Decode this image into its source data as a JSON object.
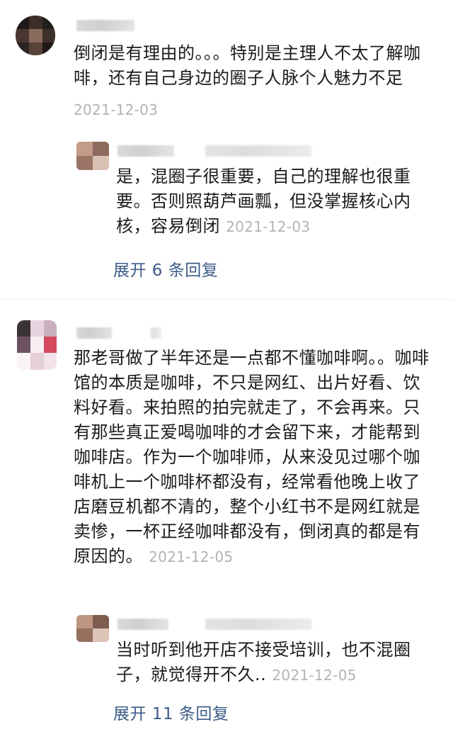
{
  "comments": [
    {
      "text": "倒闭是有理由的。。。特别是主理人不太了解咖啡，还有自己身边的圈子人脉个人魅力不足",
      "date": "2021-12-03",
      "reply": {
        "text": "是，混圈子很重要，自己的理解也很重要。否则照葫芦画瓢，但没掌握核心内核，容易倒闭",
        "date": "2021-12-03"
      },
      "expand_label": "展开 6 条回复"
    },
    {
      "text": "那老哥做了半年还是一点都不懂咖啡啊。。咖啡馆的本质是咖啡，不只是网红、出片好看、饮料好看。来拍照的拍完就走了，不会再来。只有那些真正爱喝咖啡的才会留下来，才能帮到咖啡店。作为一个咖啡师，从来没见过哪个咖啡机上一个咖啡杯都没有，经常看他晚上收了店磨豆机都不清的，整个小红书不是网红就是卖惨，一杯正经咖啡都没有，倒闭真的都是有原因的。",
      "date": "2021-12-05",
      "reply": {
        "text": "当时听到他开店不接受培训，也不混圈子，就觉得开不久..",
        "date": "2021-12-05"
      },
      "expand_label": "展开 11 条回复"
    }
  ],
  "colors": {
    "text": "#1b1b1b",
    "date": "#b3b3b3",
    "link": "#3d5c87",
    "divider": "#efefef"
  }
}
